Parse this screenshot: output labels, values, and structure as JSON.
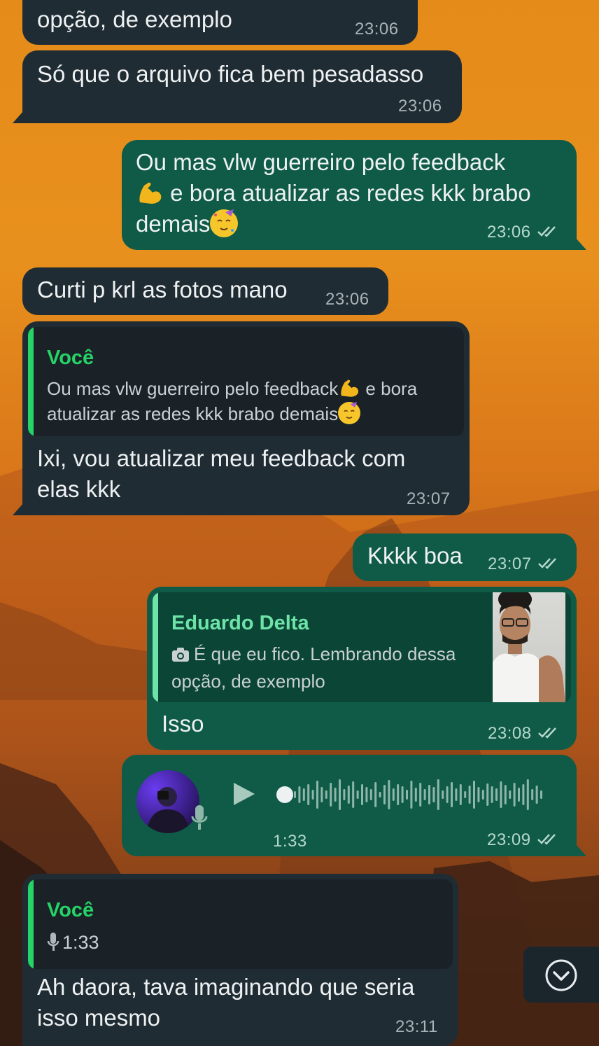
{
  "messages": [
    {
      "text": "opção, de exemplo",
      "time": "23:06"
    },
    {
      "text": "Só que o arquivo fica bem pesadasso",
      "time": "23:06"
    },
    {
      "line1": "Ou mas vlw guerreiro pelo feedback",
      "line2": " e bora atualizar as redes kkk brabo",
      "line3": "demais",
      "time": "23:06"
    },
    {
      "text": "Curti p krl as fotos mano",
      "time": "23:06"
    },
    {
      "quote_name": "Você",
      "quote_line1": "Ou mas vlw guerreiro pelo feedback",
      "quote_line1b": " e bora",
      "quote_line2": "atualizar as redes kkk brabo demais",
      "line1": "Ixi, vou atualizar meu feedback com",
      "line2": "elas kkk",
      "time": "23:07"
    },
    {
      "text": "Kkkk boa",
      "time": "23:07"
    },
    {
      "quote_name": "Eduardo Delta",
      "quote_line1": "É que eu fico. Lembrando dessa",
      "quote_line2": "opção, de exemplo",
      "text": "Isso",
      "time": "23:08"
    },
    {
      "duration": "1:33",
      "time": "23:09",
      "progress": 0
    },
    {
      "quote_name": "Você",
      "quote_duration": "1:33",
      "line1": "Ah daora, tava imaginando que seria",
      "line2": "isso mesmo",
      "time": "23:11"
    }
  ],
  "colors": {
    "incoming": "#202c33",
    "outgoing": "#0f5b47",
    "accent": "#25d366",
    "tick": "#b6d8cc"
  },
  "icons": [
    "double-check-icon",
    "camera-icon",
    "mic-icon",
    "play-icon",
    "chevron-down-icon",
    "flexed-biceps-emoji",
    "partying-face-emoji"
  ]
}
